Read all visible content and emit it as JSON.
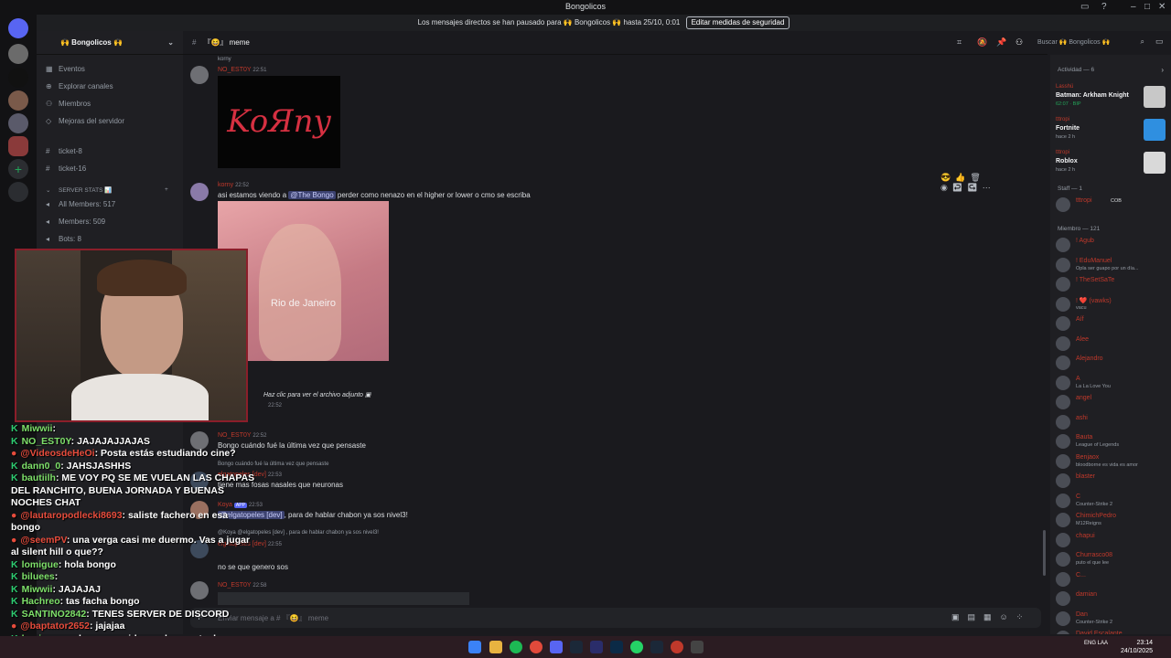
{
  "window": {
    "title": "Bongolicos"
  },
  "notice": {
    "text": "Los mensajes directos se han pausado para 🙌 Bongolicos 🙌 hasta 25/10, 0:01",
    "button": "Editar medidas de seguridad"
  },
  "guild": {
    "name": "🙌 Bongolicos 🙌"
  },
  "sidebar": {
    "items": [
      {
        "label": "Eventos",
        "icon": "calendar-icon"
      },
      {
        "label": "Explorar canales",
        "icon": "compass-icon"
      },
      {
        "label": "Miembros",
        "icon": "members-icon"
      },
      {
        "label": "Mejoras del servidor",
        "icon": "boost-icon"
      }
    ],
    "channels": [
      "ticket-8",
      "ticket-16"
    ],
    "stats_category": "SERVER STATS 📊",
    "stats": [
      "All Members: 517",
      "Members: 509",
      "Bots: 8"
    ]
  },
  "channel": {
    "name": "『😆』 meme",
    "search_placeholder": "Buscar 🙌 Bongolicos 🙌",
    "composer_placeholder": "Enviar mensaje a # 『😆』 meme"
  },
  "messages": {
    "m1_reply": "korny",
    "m1_author": "NO_EST0Y",
    "m1_time": "22:51",
    "m1_image_text": "KoЯny",
    "m2_author": "korny",
    "m2_time": "22:52",
    "m2_text_a": "asi estamos viendo a ",
    "m2_mention": "@The Bongo",
    "m2_text_b": " perder como nenazo en el higher or lower o cmo se escriba",
    "m2_image_caption": "Rio de Janeiro",
    "m3_attach": "Haz clic para ver el archivo adjunto",
    "m3_time": "22:52",
    "m4_author": "NO_EST0Y",
    "m4_time": "22:52",
    "m4_text": "Bongo cuándo fué la última vez que pensaste",
    "m5_reply": "Bongo cuándo fué la última vez que pensaste",
    "m5_author": "elgatopeles [dev]",
    "m5_time": "22:53",
    "m5_text": "tiene mas fosas nasales que neuronas",
    "m6_author": "Koya",
    "m6_time": "22:53",
    "m6_mention": "@elgatopeles [dev]",
    "m6_text": ", para de hablar chabon ya sos nivel3!",
    "m7_reply": "@Koya @elgatopeles [dev] , para de hablar chabon ya sos nivel3!",
    "m7_author": "elgatopeles [dev]",
    "m7_time": "22:55",
    "m7_text": "no se que genero sos",
    "m8_author": "NO_EST0Y",
    "m8_time": "22:58"
  },
  "members": {
    "activity_header": "Actividad — 6",
    "activities": [
      {
        "user": "Lasshü",
        "game": "Batman: Arkham Knight",
        "sub": "62:07 · BIP"
      },
      {
        "user": "tttropi",
        "game": "Fortnite",
        "sub": "hace 2 h"
      },
      {
        "user": "tttropi",
        "game": "Roblox",
        "sub": "hace 2 h"
      }
    ],
    "staff_header": "Staff — 1",
    "staff": [
      {
        "name": "tttropi",
        "tag": "COB"
      }
    ],
    "member_header": "Miembro — 121",
    "list": [
      {
        "name": "! Agub",
        "sub": ""
      },
      {
        "name": "! EduManuel",
        "sub": "Opla ser guapo por un día..."
      },
      {
        "name": "! TheSetSaTe",
        "sub": ""
      },
      {
        "name": "! ❤️ (vawks)",
        "sub": "vacu"
      },
      {
        "name": "Aíf",
        "sub": ""
      },
      {
        "name": "Alee",
        "sub": ""
      },
      {
        "name": "Alejandro",
        "sub": ""
      },
      {
        "name": "A",
        "sub": "La La Love You"
      },
      {
        "name": "angel",
        "sub": ""
      },
      {
        "name": "ashi",
        "sub": ""
      },
      {
        "name": "Bauta",
        "sub": "League of Legends"
      },
      {
        "name": "Benjaox",
        "sub": "bloodborne es vida es amor"
      },
      {
        "name": "blaster",
        "sub": ""
      },
      {
        "name": "C",
        "sub": "Counter-Strike 2"
      },
      {
        "name": "ChimichPedro",
        "sub": "M12Reigns"
      },
      {
        "name": "chapui",
        "sub": ""
      },
      {
        "name": "Churrasco08",
        "sub": "puto el que lee"
      },
      {
        "name": "C...",
        "sub": ""
      },
      {
        "name": "damian",
        "sub": ""
      },
      {
        "name": "Dan",
        "sub": "Counter-Strike 2"
      },
      {
        "name": "David Escalante",
        "sub": ""
      }
    ]
  },
  "stream_chat": [
    {
      "user": "Miwwii",
      "msg": ""
    },
    {
      "user": "NO_EST0Y",
      "msg": "JAJAJAJJAJAS"
    },
    {
      "user": "@VideosdeHeOi",
      "msg": "Posta estás estudiando cine?"
    },
    {
      "user": "dann0_0",
      "msg": "JAHSJASHHS"
    },
    {
      "user": "bautiilh",
      "msg": "ME VOY PQ SE ME VUELAN LAS CHAPAS DEL RANCHITO, BUENA JORNADA Y BUENAS NOCHES CHAT"
    },
    {
      "user": "@lautaropodlecki8693",
      "msg": "saliste fachero en esa bongo"
    },
    {
      "user": "@seemPV",
      "msg": "una verga casi me duermo. Vas a jugar al silent hill o que??"
    },
    {
      "user": "lomigue",
      "msg": "hola bongo"
    },
    {
      "user": "biluees",
      "msg": ""
    },
    {
      "user": "Miwwii",
      "msg": "JAJAJAJ"
    },
    {
      "user": "Hachreo",
      "msg": "tas facha bongo"
    },
    {
      "user": "SANTINO2842",
      "msg": "TENES SERVER DE DISCORD"
    },
    {
      "user": "@baptator2652",
      "msg": "jajajaa"
    },
    {
      "user": "lomigue",
      "msg": "pq haces un video cada muerte de"
    }
  ],
  "taskbar": {
    "lang": "ENG LAA",
    "time": "23:14",
    "date": "24/10/2025"
  },
  "colors": {
    "accent": "#5865f2",
    "mention_bg": "#3c4270",
    "role_red": "#c0392b",
    "webcam_border": "#8b1e2a"
  }
}
